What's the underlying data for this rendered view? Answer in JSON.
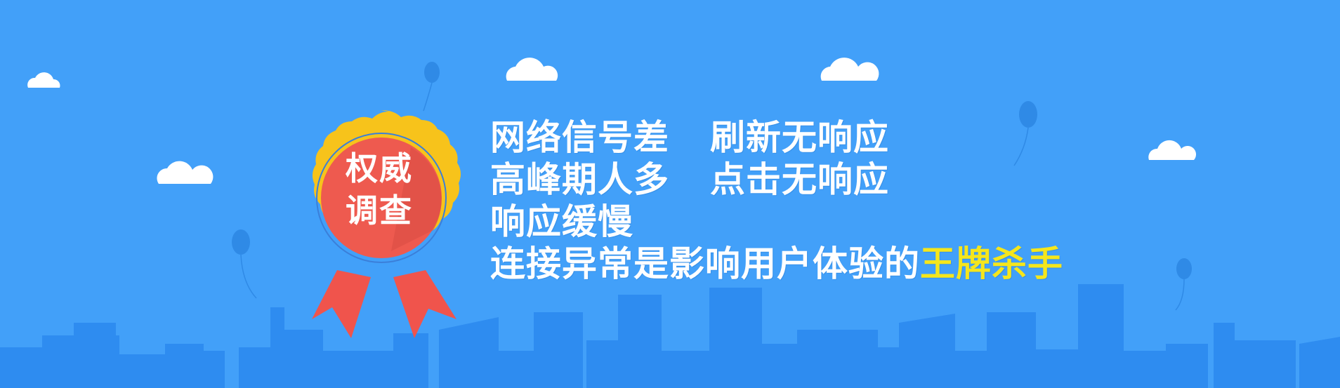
{
  "colors": {
    "sky": "#42a0f9",
    "skyline": "#2e8cf0",
    "cloud": "#ffffff",
    "balloon": "#2f8ae6",
    "badge_gold": "#f7c31b",
    "badge_red": "#ee5a4f",
    "ribbon": "#f0544c",
    "text": "#ffffff",
    "highlight": "#f5e61c"
  },
  "badge": {
    "line1": "权威",
    "line2": "调查"
  },
  "headline": {
    "line1_a": "网络信号差",
    "line1_b": "刷新无响应",
    "line2_a": "高峰期人多",
    "line2_b": "点击无响应",
    "line3": "响应缓慢",
    "line4_plain": "连接异常是影响用户体验的",
    "line4_highlight": "王牌杀手"
  },
  "decorations": {
    "cloud_icon": "cloud-icon",
    "balloon_icon": "balloon-icon",
    "skyline": "city-skyline"
  }
}
